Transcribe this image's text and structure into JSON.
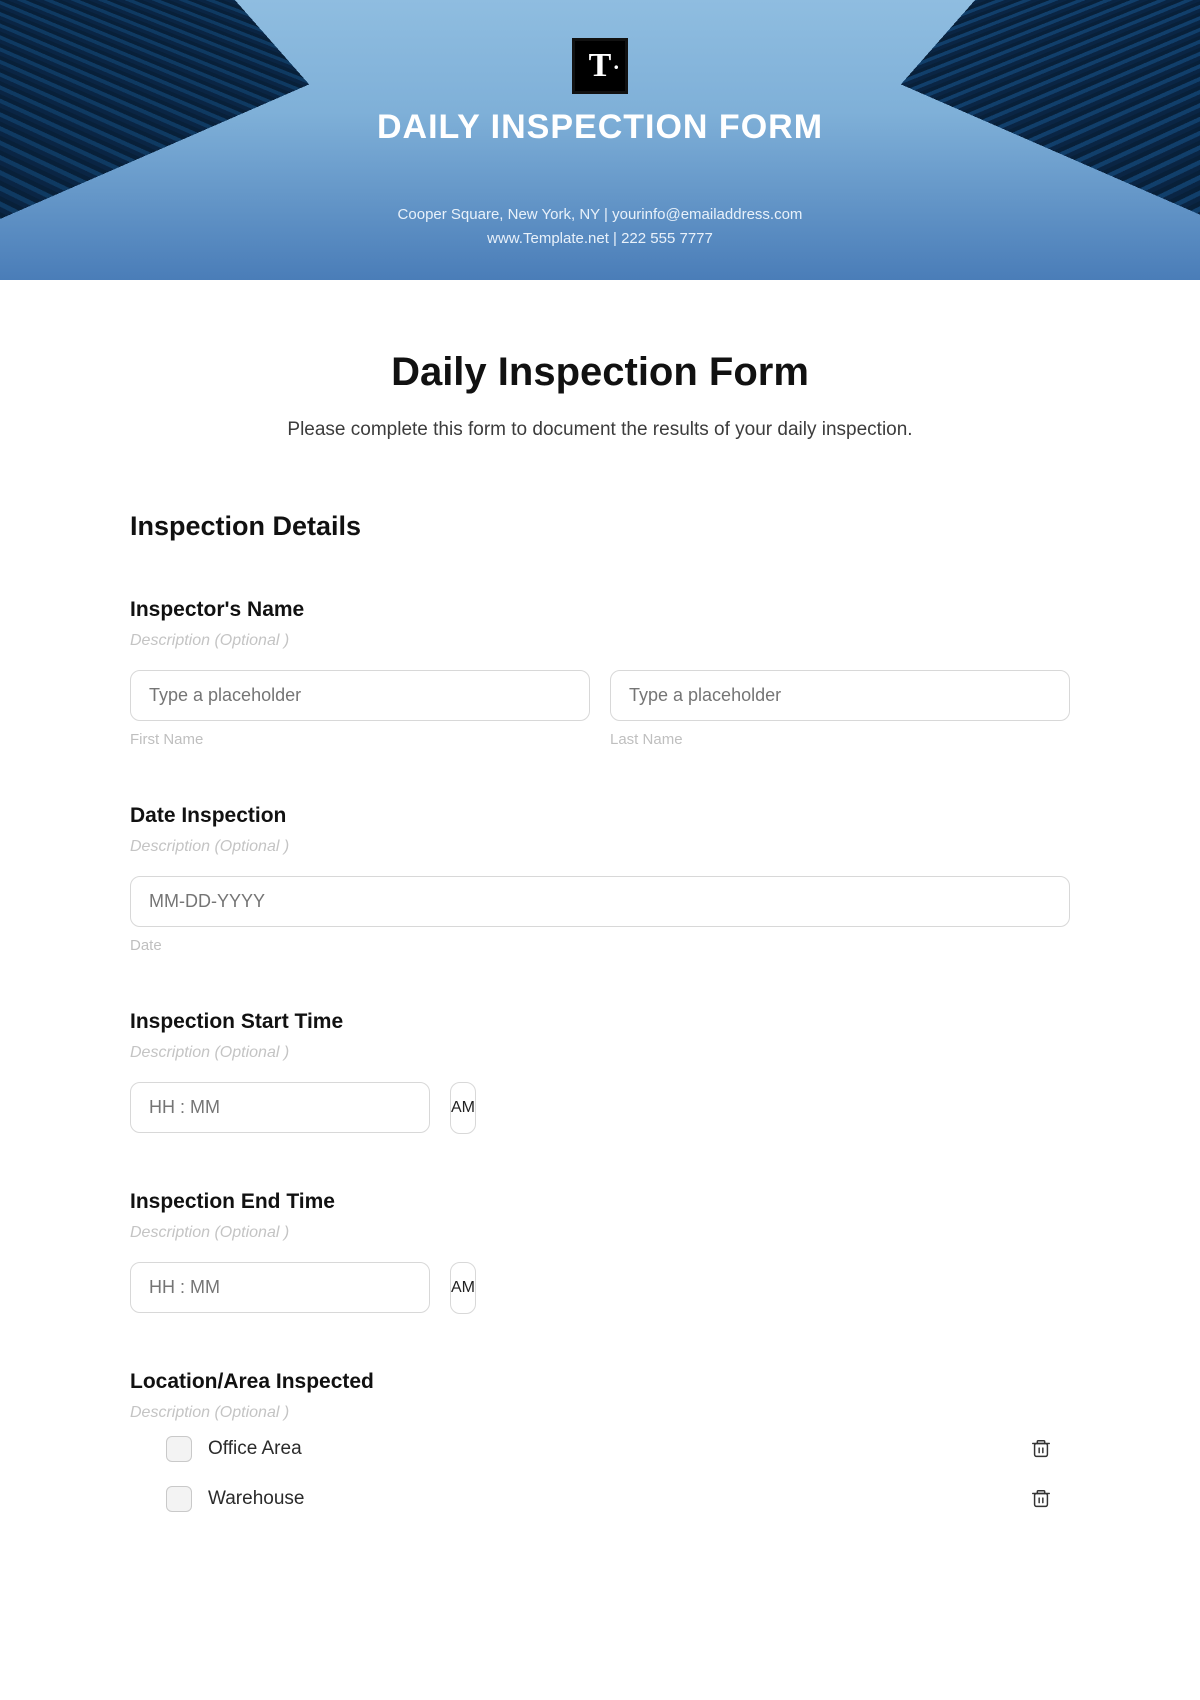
{
  "header": {
    "logo_text": "T",
    "title": "DAILY INSPECTION FORM",
    "contact_line1": "Cooper Square, New York, NY  |  yourinfo@emailaddress.com",
    "contact_line2": "www.Template.net  |  222 555 7777"
  },
  "form": {
    "title": "Daily Inspection Form",
    "subtitle": "Please complete this form to document the results of your daily inspection.",
    "section_heading": "Inspection  Details",
    "description_placeholder": "Description  (Optional )",
    "inspector": {
      "label": "Inspector's Name",
      "first_placeholder": "Type a placeholder",
      "first_sublabel": "First Name",
      "last_placeholder": "Type a placeholder",
      "last_sublabel": "Last Name"
    },
    "date": {
      "label": "Date Inspection",
      "placeholder": "MM-DD-YYYY",
      "sublabel": "Date"
    },
    "start_time": {
      "label": "Inspection Start Time",
      "placeholder": "HH : MM",
      "ampm": "AM"
    },
    "end_time": {
      "label": "Inspection End Time",
      "placeholder": "HH : MM",
      "ampm": "AM"
    },
    "location": {
      "label": "Location/Area Inspected",
      "options": [
        "Office Area",
        "Warehouse"
      ]
    }
  }
}
